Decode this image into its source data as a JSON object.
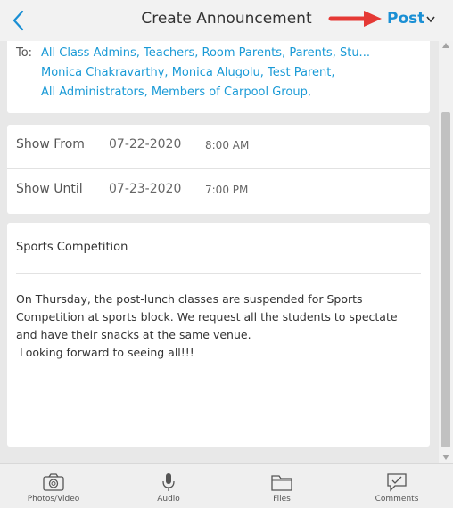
{
  "header": {
    "title": "Create Announcement",
    "post_label": "Post",
    "accent": "#1a8fd4"
  },
  "recipients": {
    "label": "To:",
    "line1": "All Class Admins, Teachers, Room Parents, Parents, Stu...",
    "line2": "Monica Chakravarthy,  Monica Alugolu,  Test Parent,",
    "line3": "All Administrators, Members of Carpool Group,"
  },
  "schedule": {
    "show_from_label": "Show From",
    "show_from_date": "07-22-2020",
    "show_from_time": "8:00 AM",
    "show_until_label": "Show Until",
    "show_until_date": "07-23-2020",
    "show_until_time": "7:00 PM"
  },
  "message": {
    "subject": "Sports Competition",
    "body_line1": "On Thursday, the post-lunch classes are suspended for Sports",
    "body_line2": "Competition at sports block. We request all the students to spectate",
    "body_line3": "and have their snacks at the same venue.",
    "body_line4": " Looking forward to seeing all!!!"
  },
  "toolbar": {
    "photos_label": "Photos/Video",
    "audio_label": "Audio",
    "files_label": "Files",
    "comments_label": "Comments"
  },
  "icons": [
    "back-arrow-icon",
    "chevron-down-icon",
    "camera-icon",
    "microphone-icon",
    "folder-icon",
    "comment-icon"
  ]
}
